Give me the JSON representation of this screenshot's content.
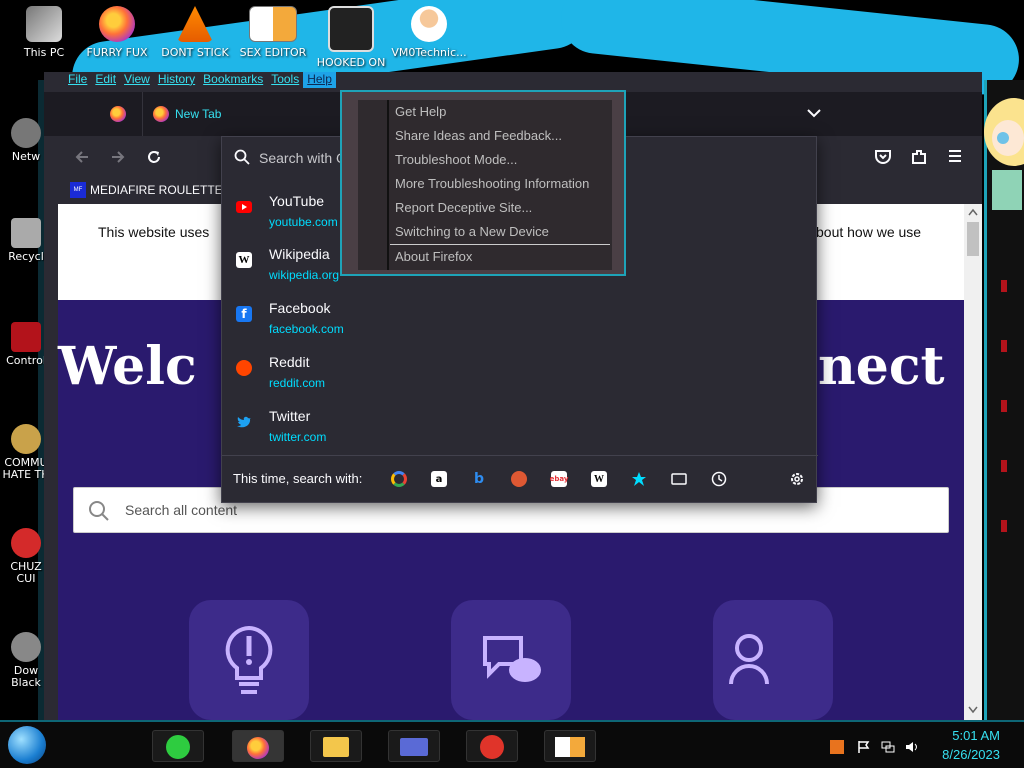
{
  "desktop": {
    "icons": [
      {
        "label": "This PC"
      },
      {
        "label": "FURRY FUX"
      },
      {
        "label": "DONT STICK"
      },
      {
        "label": "SEX EDITOR"
      },
      {
        "label": "HOOKED ON"
      },
      {
        "label": "VM0Technic..."
      }
    ],
    "left_icons": [
      {
        "label": "Netw"
      },
      {
        "label": "Recycl"
      },
      {
        "label": "Control"
      },
      {
        "label": "COMMU HATE TH"
      },
      {
        "label": "CHUZ CUI"
      },
      {
        "label": "Dow Black"
      }
    ]
  },
  "menubar": {
    "items": [
      "File",
      "Edit",
      "View",
      "History",
      "Bookmarks",
      "Tools",
      "Help"
    ],
    "active": "Help"
  },
  "tab": {
    "label": "New Tab"
  },
  "url_bar": {
    "placeholder": "Search with G"
  },
  "bookmarks_bar": {
    "items": [
      {
        "label": "MEDIAFIRE ROULETTER",
        "icon": "MF"
      }
    ]
  },
  "page": {
    "cookie_text_left": "This website uses",
    "cookie_text_right": "bout how we use",
    "welcome_left": "Welc",
    "welcome_right": "nect",
    "search_placeholder": "Search all content"
  },
  "url_dropdown": {
    "suggestions": [
      {
        "title": "YouTube",
        "url": "youtube.com",
        "color": "#ff0000"
      },
      {
        "title": "Wikipedia",
        "url": "wikipedia.org",
        "color": "#ffffff"
      },
      {
        "title": "Facebook",
        "url": "facebook.com",
        "color": "#1877f2"
      },
      {
        "title": "Reddit",
        "url": "reddit.com",
        "color": "#ff4500"
      },
      {
        "title": "Twitter",
        "url": "twitter.com",
        "color": "#1da1f2"
      }
    ],
    "search_with_label": "This time, search with:",
    "engines": [
      "google-icon",
      "amazon-icon",
      "bing-icon",
      "duckduckgo-icon",
      "ebay-icon",
      "wikipedia-icon",
      "bookmarks-icon",
      "tabs-icon",
      "history-icon"
    ]
  },
  "help_menu": {
    "items": [
      "Get Help",
      "Share Ideas and Feedback...",
      "Troubleshoot Mode...",
      "More Troubleshooting Information",
      "Report Deceptive Site...",
      "Switching to a New Device",
      "About Firefox"
    ]
  },
  "taskbar": {
    "time": "5:01 AM",
    "date": "8/26/2023"
  },
  "colors": {
    "accent_cyan": "#36e0f0",
    "browser_bg": "#2b2a33",
    "page_purple": "#2a1a6e",
    "link_cyan": "#00ddff"
  }
}
